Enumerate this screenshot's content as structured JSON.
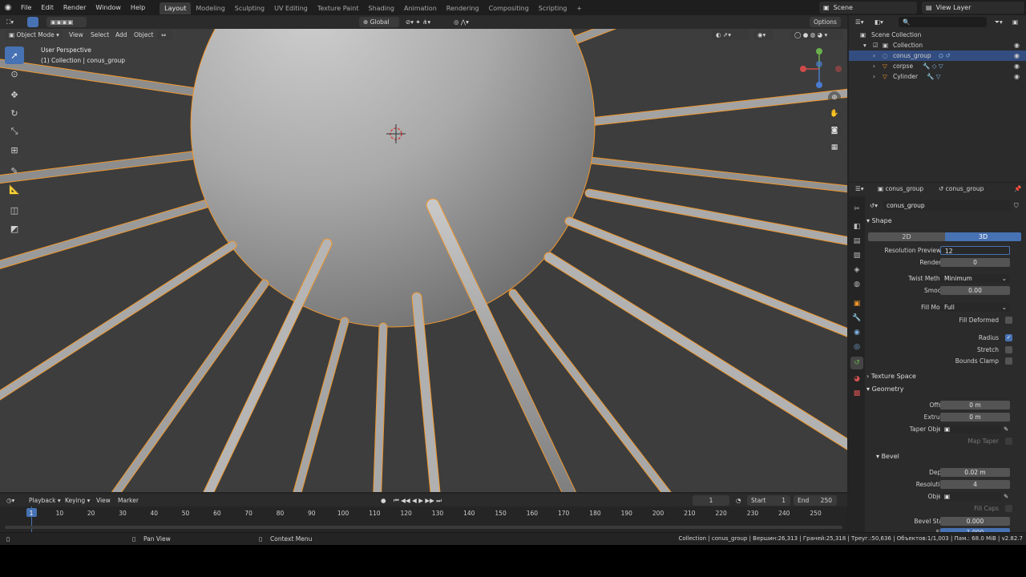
{
  "menu": [
    "File",
    "Edit",
    "Render",
    "Window",
    "Help"
  ],
  "workspaces": [
    "Layout",
    "Modeling",
    "Sculpting",
    "UV Editing",
    "Texture Paint",
    "Shading",
    "Animation",
    "Rendering",
    "Compositing",
    "Scripting"
  ],
  "scene_name": "Scene",
  "view_layer": "View Layer",
  "viewport": {
    "mode": "Object Mode",
    "menus": [
      "View",
      "Select",
      "Add",
      "Object"
    ],
    "transform": "Global",
    "options": "Options",
    "overlay_line1": "User Perspective",
    "overlay_line2": "(1) Collection | conus_group"
  },
  "outliner": {
    "rows": [
      {
        "label": "Scene Collection",
        "indent": 0,
        "selected": false
      },
      {
        "label": "Collection",
        "indent": 1,
        "selected": false
      },
      {
        "label": "conus_group",
        "indent": 2,
        "selected": true
      },
      {
        "label": "corpse",
        "indent": 2,
        "selected": false
      },
      {
        "label": "Cylinder",
        "indent": 2,
        "selected": false
      }
    ]
  },
  "properties": {
    "header_left": "conus_group",
    "header_right": "conus_group",
    "data_name": "conus_group",
    "shape_section": "Shape",
    "btn_2d": "2D",
    "btn_3d": "3D",
    "res_preview_label": "Resolution Preview U",
    "res_preview_value": "12",
    "render_u_label": "Render U",
    "render_u_value": "0",
    "twist_label": "Twist Method",
    "twist_value": "Minimum",
    "smooth_label": "Smooth",
    "smooth_value": "0.00",
    "fill_mode_label": "Fill Mode",
    "fill_mode_value": "Full",
    "fill_deformed": "Fill Deformed",
    "radius": "Radius",
    "stretch": "Stretch",
    "bounds_clamp": "Bounds Clamp",
    "texture_space": "Texture Space",
    "geometry": "Geometry",
    "offset_label": "Offset",
    "offset_value": "0 m",
    "extrude_label": "Extrude",
    "extrude_value": "0 m",
    "taper_label": "Taper Object",
    "map_taper": "Map Taper",
    "bevel": "Bevel",
    "depth_label": "Depth",
    "depth_value": "0.02 m",
    "resolution_label": "Resolution",
    "resolution_value": "4",
    "object_label": "Object",
    "fill_caps": "Fill Caps",
    "bevel_start_label": "Bevel Start",
    "bevel_start_value": "0.000",
    "end_label": "End",
    "end_value": "1.000"
  },
  "timeline": {
    "menus": [
      "Playback",
      "Keying",
      "View",
      "Marker"
    ],
    "current_frame": "1",
    "start_label": "Start",
    "start_value": "1",
    "end_label": "End",
    "end_value": "250",
    "ticks": [
      "1",
      "10",
      "20",
      "30",
      "40",
      "50",
      "60",
      "70",
      "80",
      "90",
      "100",
      "110",
      "120",
      "130",
      "140",
      "150",
      "160",
      "170",
      "180",
      "190",
      "200",
      "210",
      "220",
      "230",
      "240",
      "250"
    ]
  },
  "status": {
    "pan": "Pan View",
    "context": "Context Menu",
    "stats": "Collection | conus_group | Вершин:26,313 | Граней:25,318 | Треуг.:50,636 | Объектов:1/1,003 | Пам.: 68.0 MiB | v2.82.7"
  },
  "colors": {
    "accent": "#4772b3",
    "selection": "#f0962b",
    "outliner_sel": "#334d80"
  }
}
